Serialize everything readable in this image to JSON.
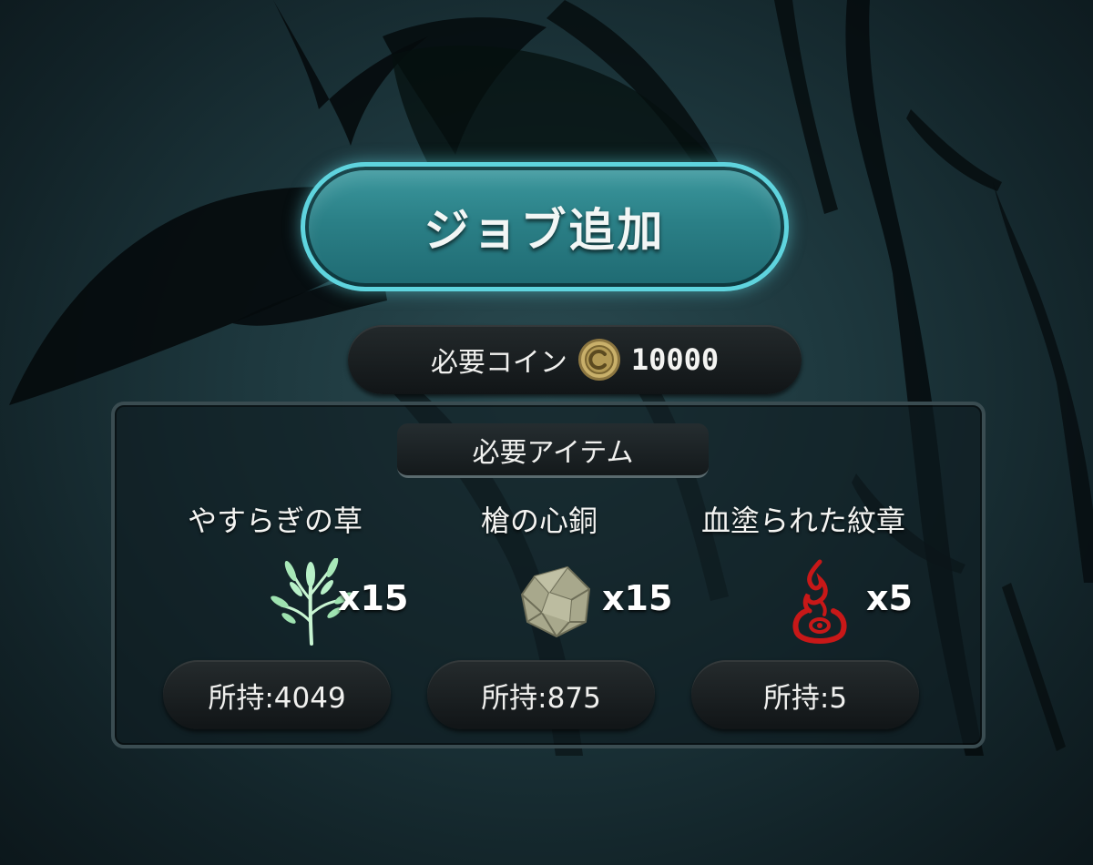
{
  "job_add_button": {
    "label": "ジョブ追加"
  },
  "required_coins": {
    "label": "必要コイン",
    "icon": "coin-icon",
    "value": "10000"
  },
  "required_items": {
    "header": "必要アイテム",
    "items": [
      {
        "name": "やすらぎの草",
        "icon": "herb-icon",
        "icon_color": "#b8f0c8",
        "quantity": "x15",
        "owned": "所持:4049"
      },
      {
        "name": "槍の心銅",
        "icon": "ore-icon",
        "icon_color": "#b4b49a",
        "quantity": "x15",
        "owned": "所持:875"
      },
      {
        "name": "血塗られた紋章",
        "icon": "blood-crest-icon",
        "icon_color": "#c81818",
        "quantity": "x5",
        "owned": "所持:5"
      }
    ]
  },
  "colors": {
    "button_border": "#5fd4de",
    "button_fill": "#2b8087",
    "background": "#1d373d"
  }
}
